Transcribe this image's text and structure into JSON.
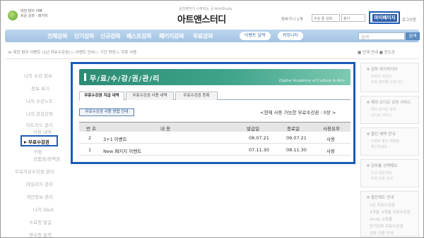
{
  "header": {
    "logo_line1": "대한 밤이 이뻐",
    "logo_line2": "쉬운 강좌 - 패키지",
    "brand_sub": "실전영어가 시작되는 곳 ArtnStudy",
    "brand": "아트앤스터디",
    "cart_link": "장바구니 1개",
    "select_label": "수강 중 강좌",
    "select2_label": "찾기",
    "mypage": "마이페이지",
    "logout": "로그아웃"
  },
  "nav": {
    "items": [
      "전체강좌",
      "단기강좌",
      "신규강좌",
      "베스트강좌",
      "패키지강좌",
      "무료강좌"
    ],
    "pill_event": "이벤트 달력",
    "pill_community": "커뮤니티",
    "search_placeholder": "검색",
    "search_button": "검색"
  },
  "breadcrumb": {
    "text": "≫ 대한 밤이 이벤트 (1년 자유수강권) ▷ 이벤트 안내 ▷ 기간 연장 ▷ 쿠폰 사용",
    "right_link1": "■ 단계 안내",
    "right_link2": "■ 진도관"
  },
  "left_menu": {
    "items": [
      "나의 수강 정보",
      "정보 보기",
      "나의 수강노트",
      "나의 관심강좌",
      "아트카드 관리",
      "이용 내역"
    ],
    "active": "무료수강권",
    "sub_items": [
      "구매",
      "상품권/정액권"
    ],
    "items_bottom": [
      "무료자유수강권 관리",
      "마일리지 관리",
      "개인정보 관리",
      "나의 Q&A",
      "수료증 발급",
      "영수증 출력"
    ]
  },
  "main": {
    "title": "무/료/수/강/권/관/리",
    "title_sub": "Digital Academy of Culture & Arts",
    "tabs": [
      "무료수강권 지급 내역",
      "무료수강권 사용 내역",
      "무료수강권 등록"
    ],
    "guide_button": "무료수강권 사용 방법 안내",
    "coupon_count": "<현재 사용 가능한 무료수강권 : 0장 >",
    "table_headers": [
      "번 호",
      "내 용",
      "발급일",
      "종료일",
      "사용유무"
    ],
    "rows": [
      {
        "no": "2",
        "content": "3+1 이벤트",
        "issued": "08.07.21",
        "expires": "09.07.21",
        "status": "사용"
      },
      {
        "no": "1",
        "content": "New 패키지 이벤트",
        "issued": "07.11.30",
        "expires": "08.11.30",
        "status": "사용"
      }
    ]
  },
  "sidebar": {
    "box1_title": "강좌 위키피디아",
    "box1_text": [
      "강좌의 핵심만",
      "쏙쏙 정리해 드립니다"
    ],
    "box2_title": "해외 오디오 강좌 서비스",
    "box2_text": [
      "해외 원어민 강좌",
      "오디오 서비스"
    ],
    "box3_title": "할인 혜택 안내",
    "box3_text": [
      "이벤트 할인 혜택을",
      "확인하세요"
    ],
    "box4_title": "강좌를 선택해요",
    "box4_text": [
      "신규 입문자를",
      "위한 강좌 안내"
    ],
    "list_title": "할인제도 안내",
    "list_items": [
      "1년 자유수강권",
      "3개월, 6개월 자유수강권",
      "study 쇼핑몰",
      "단기강좌 무료수강권",
      "강좌 이용 안내"
    ]
  }
}
